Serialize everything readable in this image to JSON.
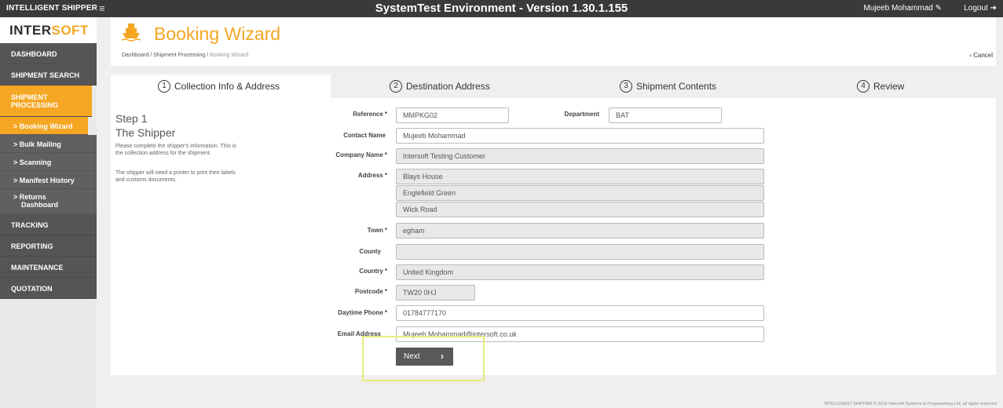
{
  "topbar": {
    "app_name": "INTELLIGENT SHIPPER",
    "menu_icon": "≡",
    "environment": "SystemTest Environment - Version 1.30.1.155",
    "user": "Mujeeb Mohammad",
    "user_icon": "✎",
    "logout": "Logout",
    "logout_icon": "➜"
  },
  "logo": {
    "part1": "INTER",
    "part2": "SOFT"
  },
  "sidebar": {
    "items": [
      {
        "label": "DASHBOARD"
      },
      {
        "label": "SHIPMENT SEARCH"
      },
      {
        "label": "SHIPMENT PROCESSING"
      }
    ],
    "sub_items": [
      {
        "label": "> Booking Wizard"
      },
      {
        "label": "> Bulk Mailing"
      },
      {
        "label": "> Scanning"
      },
      {
        "label": "> Manifest History"
      },
      {
        "label": "> Returns",
        "label2": "Dashboard"
      }
    ],
    "items_after": [
      {
        "label": "TRACKING"
      },
      {
        "label": "REPORTING"
      },
      {
        "label": "MAINTENANCE"
      },
      {
        "label": "QUOTATION"
      }
    ]
  },
  "header": {
    "title": "Booking Wizard",
    "breadcrumb": [
      "Dashboard",
      "Shipment Processing",
      "Booking Wizard"
    ],
    "breadcrumb_sep": "/",
    "cancel": "‹ Cancel"
  },
  "tabs": [
    {
      "num": "1",
      "label": "Collection Info & Address"
    },
    {
      "num": "2",
      "label": "Destination Address"
    },
    {
      "num": "3",
      "label": "Shipment Contents"
    },
    {
      "num": "4",
      "label": "Review"
    }
  ],
  "step": {
    "number": "Step 1",
    "title": "The Shipper",
    "desc": "Please complete the shipper's information. This is the collection address for the shipment.",
    "desc2": "The shipper will need a printer to print their labels and customs documents."
  },
  "form": {
    "reference": {
      "label": "Reference",
      "value": "MMPKG02"
    },
    "department": {
      "label": "Department",
      "value": "BAT"
    },
    "contact_name": {
      "label": "Contact Name",
      "value": "Mujeeb Mohammad"
    },
    "company_name": {
      "label": "Company Name",
      "value": "Intersoft Testing Customer"
    },
    "address": {
      "label": "Address",
      "line1": "Blays House",
      "line2": "Englefield Green",
      "line3": "Wick Road"
    },
    "town": {
      "label": "Town",
      "value": "egham"
    },
    "county": {
      "label": "County",
      "value": ""
    },
    "country": {
      "label": "Country",
      "value": "United Kingdom"
    },
    "postcode": {
      "label": "Postcode",
      "value": "TW20 0HJ"
    },
    "daytime_phone": {
      "label": "Daytime Phone",
      "value": "01784777170"
    },
    "email": {
      "label": "Email Address",
      "value": "Mujeeb.Mohammad@intersoft.co.uk"
    },
    "required_mark": "*"
  },
  "next_button": {
    "label": "Next",
    "chevron": "›"
  },
  "footer": "INTELLIGENT SHIPPER © 2019 Intersoft Systems & Programming Ltd, all rights reserved",
  "colors": {
    "accent": "#f5a623",
    "topbar": "#3a3a3a",
    "sidebar": "#555555",
    "button": "#595959"
  }
}
